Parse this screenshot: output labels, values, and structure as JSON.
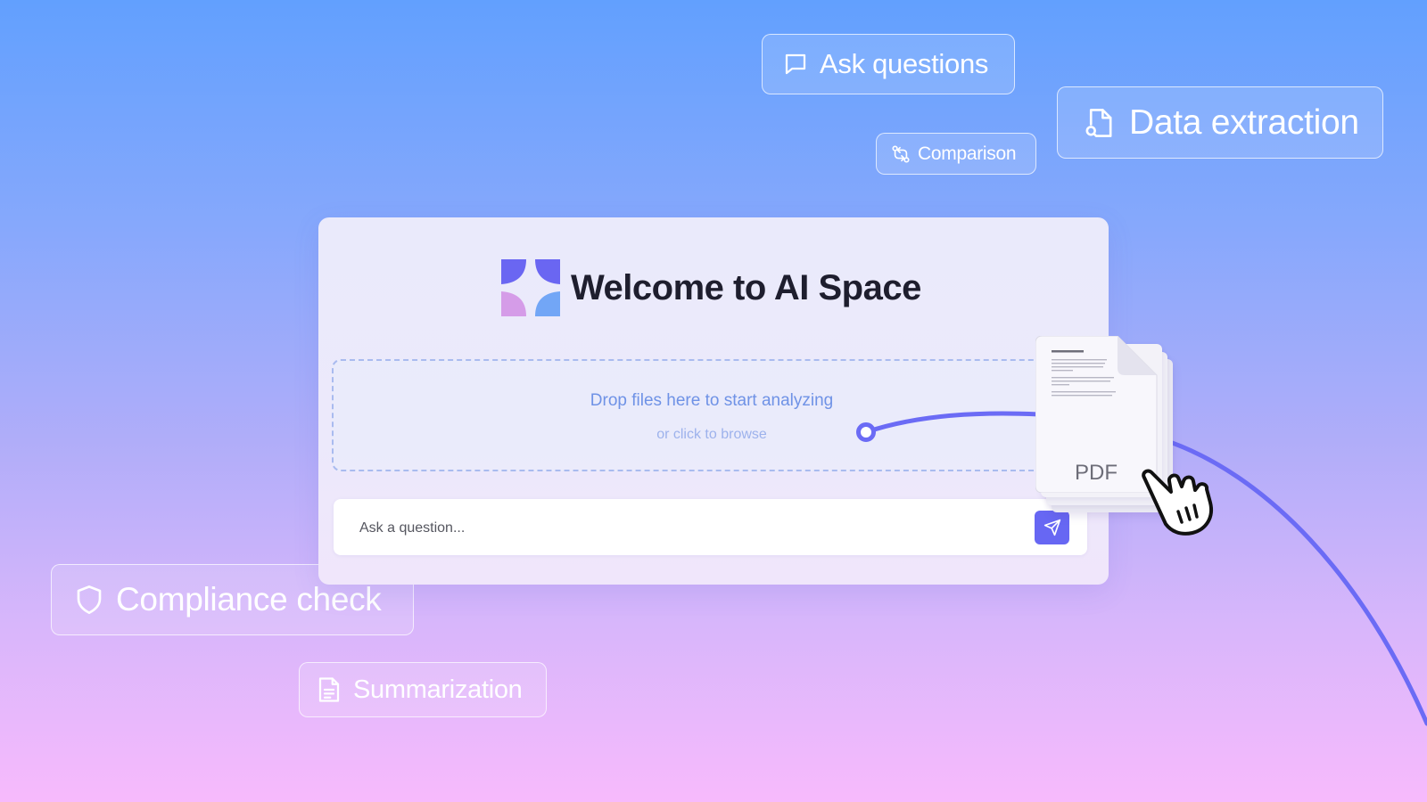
{
  "features": {
    "ask_questions": "Ask questions",
    "data_extraction": "Data extraction",
    "comparison": "Comparison",
    "compliance_check": "Compliance check",
    "summarization": "Summarization"
  },
  "app": {
    "title": "Welcome to AI Space"
  },
  "dropzone": {
    "title": "Drop files here to start analyzing",
    "subtitle": "or click to browse"
  },
  "ask_input": {
    "placeholder": "Ask a question...",
    "value": ""
  },
  "file": {
    "type_label": "PDF"
  },
  "icons": {
    "ask_questions": "chat-bubble-icon",
    "data_extraction": "file-search-icon",
    "comparison": "git-compare-icon",
    "compliance_check": "shield-icon",
    "summarization": "document-icon",
    "send": "send-icon",
    "cursor": "hand-pointer-icon",
    "logo": "ai-space-logo"
  },
  "colors": {
    "accent": "#6767f3",
    "logo_tl": "#6a66f2",
    "logo_tr": "#6a66f2",
    "logo_bl": "#d59ce8",
    "logo_br": "#72a6f6",
    "drop_text": "#6f92e6",
    "connector": "#6b6bf5"
  }
}
